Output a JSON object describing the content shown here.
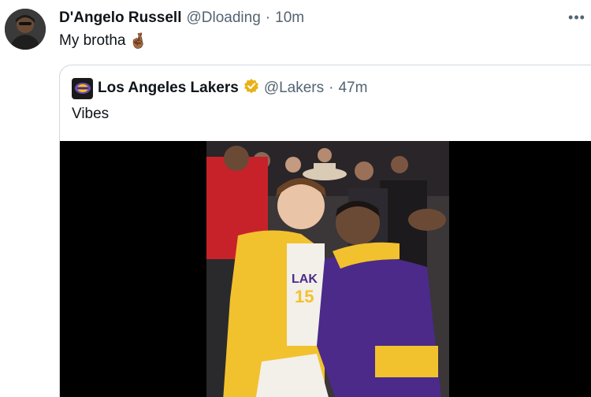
{
  "tweet": {
    "display_name": "D'Angelo Russell",
    "handle": "@Dloading",
    "separator": "·",
    "time": "10m",
    "text": "My brotha",
    "emoji": "🤞🏾",
    "more_icon": "more-horizontal-icon"
  },
  "quoted": {
    "display_name": "Los Angeles Lakers",
    "verified_icon": "verified-badge-icon",
    "verified_color": "#e9b116",
    "handle": "@Lakers",
    "separator": "·",
    "time": "47m",
    "text": "Vibes",
    "video_jersey": {
      "team": "LAK",
      "number": "15"
    }
  },
  "colors": {
    "text_primary": "#0f1419",
    "text_secondary": "#536471",
    "border": "#cfd9de",
    "lakers_gold": "#f6c125",
    "lakers_purple": "#4b2a8a"
  }
}
